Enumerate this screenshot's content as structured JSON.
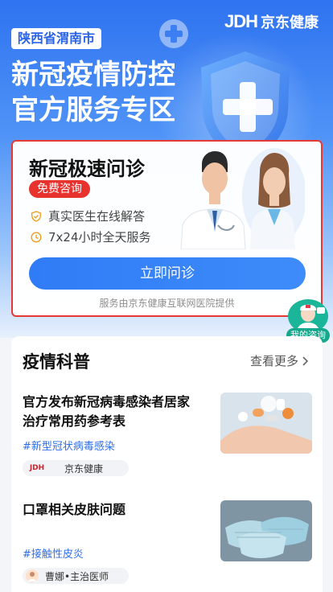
{
  "header": {
    "location": "陕西省渭南市",
    "brand_logo": "JDH",
    "brand_name": "京东健康",
    "title_line1": "新冠疫情防控",
    "title_line2": "官方服务专区"
  },
  "consult_card": {
    "title": "新冠极速问诊",
    "badge": "免费咨询",
    "features": [
      "真实医生在线解答",
      "7x24小时全天服务"
    ],
    "button_label": "立即问诊",
    "provider": "服务由京东健康互联网医院提供"
  },
  "float_button": {
    "label": "我的咨询"
  },
  "science": {
    "title": "疫情科普",
    "more_label": "查看更多",
    "articles": [
      {
        "title": "官方发布新冠病毒感染者居家治疗常用药参考表",
        "tag": "#新型冠状病毒感染",
        "author": "京东健康",
        "author_logo": "JDH"
      },
      {
        "title": "口罩相关皮肤问题",
        "tag": "#接触性皮炎",
        "author": "曹娜•主治医师"
      }
    ]
  },
  "colors": {
    "primary": "#2f7cf6",
    "highlight_border": "#e53935",
    "badge_red": "#e8322e",
    "float_green": "#16a88c"
  }
}
